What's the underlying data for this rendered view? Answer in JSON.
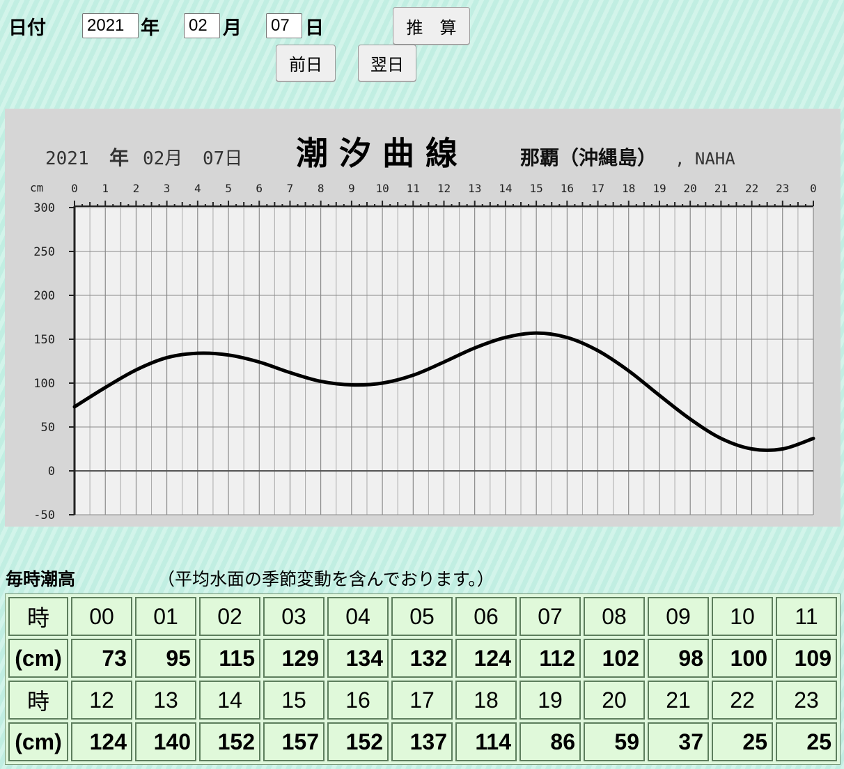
{
  "date_form": {
    "label": "日付",
    "year_value": "2021",
    "year_unit": "年",
    "month_value": "02",
    "month_unit": "月",
    "day_value": "07",
    "day_unit": "日",
    "calc_button": "推　算",
    "prev_button": "前日",
    "next_button": "翌日"
  },
  "chart_data": {
    "type": "line",
    "header_date_year": "2021",
    "header_date_year_unit": "年",
    "header_date_month": "02月",
    "header_date_day": "07日",
    "title": "潮 汐 曲 線",
    "location": "那覇（沖縄島）",
    "location_en": ", NAHA",
    "y_unit": "cm",
    "ylim": [
      -50,
      300
    ],
    "y_ticks": [
      300,
      250,
      200,
      150,
      100,
      50,
      0,
      -50
    ],
    "x_ticks": [
      "0",
      "1",
      "2",
      "3",
      "4",
      "5",
      "6",
      "7",
      "8",
      "9",
      "10",
      "11",
      "12",
      "13",
      "14",
      "15",
      "16",
      "17",
      "18",
      "19",
      "20",
      "21",
      "22",
      "23",
      "0"
    ],
    "xlim": [
      0,
      24
    ],
    "series": [
      {
        "name": "",
        "x": [
          0,
          1,
          2,
          3,
          4,
          5,
          6,
          7,
          8,
          9,
          10,
          11,
          12,
          13,
          14,
          15,
          16,
          17,
          18,
          19,
          20,
          21,
          22,
          23,
          24
        ],
        "values": [
          73,
          95,
          115,
          129,
          134,
          132,
          124,
          112,
          102,
          98,
          100,
          109,
          124,
          140,
          152,
          157,
          152,
          137,
          114,
          86,
          59,
          37,
          25,
          25,
          37
        ]
      }
    ],
    "line_color": "#000000",
    "plot_bg": "#f0f0f0",
    "frame_bg": "#d6d6d6"
  },
  "table": {
    "title": "毎時潮高",
    "note": "（平均水面の季節変動を含んでおります。）",
    "hour_label": "時",
    "unit_label": "(cm)",
    "rows": [
      {
        "hours": [
          "00",
          "01",
          "02",
          "03",
          "04",
          "05",
          "06",
          "07",
          "08",
          "09",
          "10",
          "11"
        ],
        "values": [
          "73",
          "95",
          "115",
          "129",
          "134",
          "132",
          "124",
          "112",
          "102",
          "98",
          "100",
          "109"
        ]
      },
      {
        "hours": [
          "12",
          "13",
          "14",
          "15",
          "16",
          "17",
          "18",
          "19",
          "20",
          "21",
          "22",
          "23"
        ],
        "values": [
          "124",
          "140",
          "152",
          "157",
          "152",
          "137",
          "114",
          "86",
          "59",
          "37",
          "25",
          "25"
        ]
      }
    ]
  }
}
